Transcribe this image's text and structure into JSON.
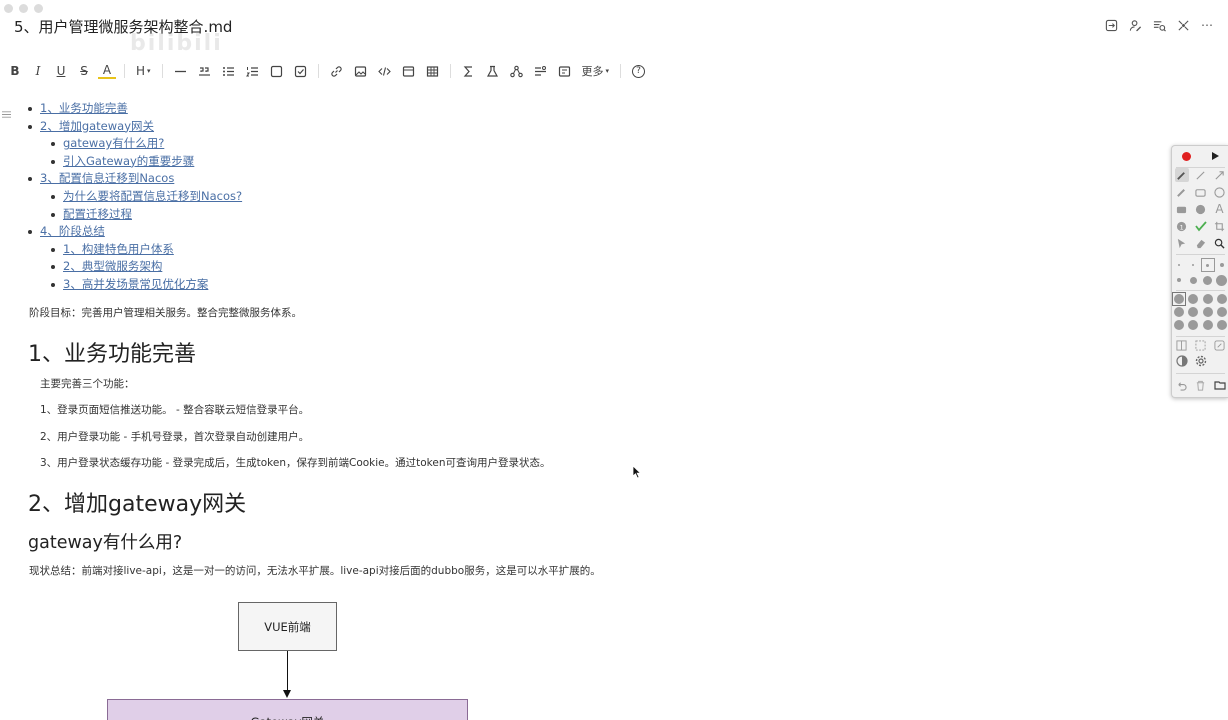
{
  "window": {
    "title": "5、用户管理微服务架构整合.md",
    "top_icons": [
      "share-icon",
      "user-edit-icon",
      "outline-icon",
      "mindmap-icon",
      "more-icon"
    ],
    "more_symbol": "⋯"
  },
  "toolbar": {
    "bold": "B",
    "italic": "I",
    "underline": "U",
    "strike": "S",
    "highlight": "A",
    "heading": "H",
    "more_label": "更多",
    "help": "?"
  },
  "toc": {
    "items": [
      {
        "label": "1、业务功能完善",
        "level": 1
      },
      {
        "label": "2、增加gateway网关",
        "level": 1
      },
      {
        "label": "gateway有什么用?",
        "level": 2
      },
      {
        "label": "引入Gateway的重要步骤",
        "level": 2
      },
      {
        "label": "3、配置信息迁移到Nacos",
        "level": 1
      },
      {
        "label": "为什么要将配置信息迁移到Nacos?",
        "level": 2
      },
      {
        "label": "配置迁移过程",
        "level": 2
      },
      {
        "label": "4、阶段总结",
        "level": 1
      },
      {
        "label": "1、构建特色用户体系",
        "level": 2
      },
      {
        "label": "2、典型微服务架构",
        "level": 2
      },
      {
        "label": "3、高并发场景常见优化方案",
        "level": 2
      }
    ]
  },
  "doc": {
    "goal": "阶段目标：完善用户管理相关服务。整合完整微服务体系。",
    "h1_business": "1、业务功能完善",
    "intro": "主要完善三个功能：",
    "features": [
      "1、登录页面短信推送功能。 - 整合容联云短信登录平台。",
      "2、用户登录功能 - 手机号登录，首次登录自动创建用户。",
      "3、用户登录状态缓存功能 - 登录完成后，生成token，保存到前端Cookie。通过token可查询用户登录状态。"
    ],
    "h1_gateway": "2、增加gateway网关",
    "h2_gateway_use": "gateway有什么用?",
    "summary": "现状总结：前端对接live-api，这是一对一的访问，无法水平扩展。live-api对接后面的dubbo服务，这是可以水平扩展的。"
  },
  "diagram": {
    "box_top": "VUE前端",
    "box_bottom": "Gateway网关"
  },
  "palette": {
    "record_color": "#e02020",
    "check_color": "#4caf50",
    "text_tool": "A"
  },
  "watermark": "bilibili"
}
